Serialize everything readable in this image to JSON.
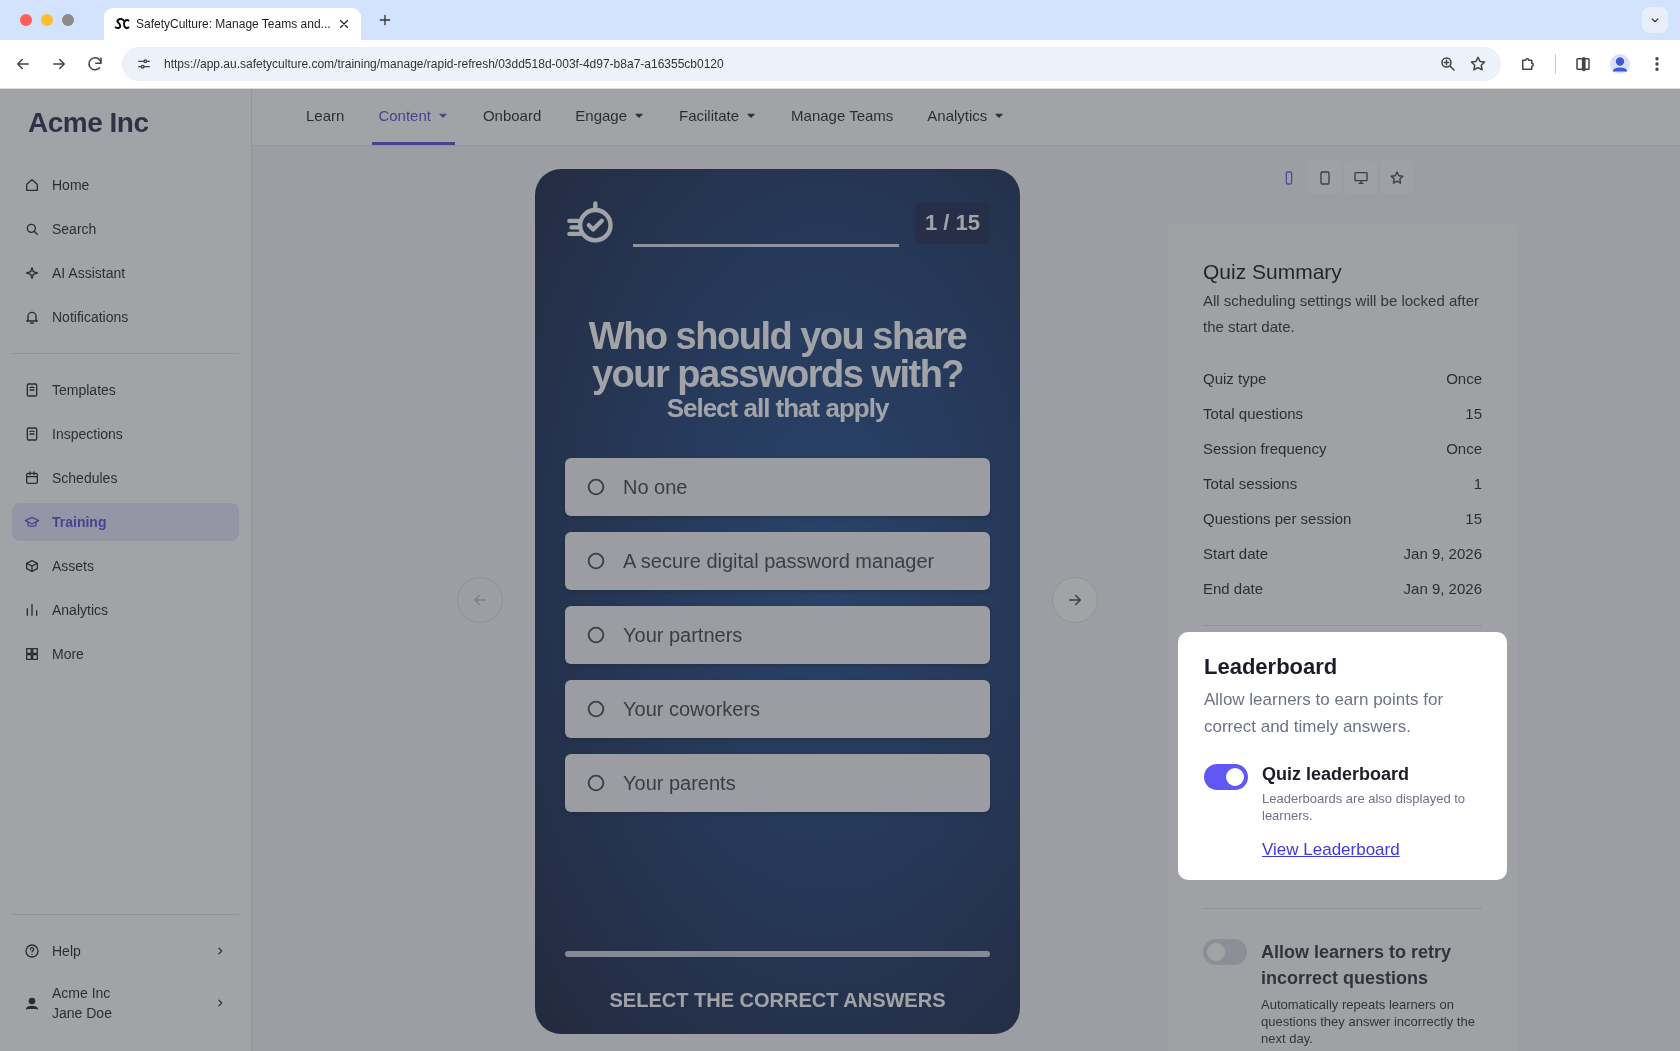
{
  "browser": {
    "tab_title": "SafetyCulture: Manage Teams and...",
    "url": "https://app.au.safetyculture.com/training/manage/rapid-refresh/03dd518d-003f-4d97-b8a7-a16355cb0120"
  },
  "sidebar": {
    "logo": "Acme Inc",
    "items": [
      {
        "label": "Home",
        "selected": false
      },
      {
        "label": "Search",
        "selected": false
      },
      {
        "label": "AI Assistant",
        "selected": false
      },
      {
        "label": "Notifications",
        "selected": false
      },
      {
        "label": "Templates",
        "selected": false
      },
      {
        "label": "Inspections",
        "selected": false
      },
      {
        "label": "Schedules",
        "selected": false
      },
      {
        "label": "Training",
        "selected": true
      },
      {
        "label": "Assets",
        "selected": false
      },
      {
        "label": "Analytics",
        "selected": false
      },
      {
        "label": "More",
        "selected": false
      }
    ],
    "help": "Help",
    "org": "Acme Inc",
    "user": "Jane Doe"
  },
  "nav_tabs": [
    {
      "label": "Learn",
      "selected": false,
      "dropdown": false
    },
    {
      "label": "Content",
      "selected": true,
      "dropdown": true
    },
    {
      "label": "Onboard",
      "selected": false,
      "dropdown": false
    },
    {
      "label": "Engage",
      "selected": false,
      "dropdown": true
    },
    {
      "label": "Facilitate",
      "selected": false,
      "dropdown": true
    },
    {
      "label": "Manage Teams",
      "selected": false,
      "dropdown": false
    },
    {
      "label": "Analytics",
      "selected": false,
      "dropdown": true
    }
  ],
  "quiz": {
    "counter": "1 / 15",
    "question": "Who should you share your passwords with?",
    "instruction": "Select all that apply",
    "options": [
      "No one",
      "A secure digital password manager",
      "Your partners",
      "Your coworkers",
      "Your parents"
    ],
    "footer": "SELECT THE CORRECT ANSWERS"
  },
  "device_buttons": [
    {
      "kind": "phone",
      "selected": true
    },
    {
      "kind": "tablet",
      "selected": false
    },
    {
      "kind": "desktop",
      "selected": false
    },
    {
      "kind": "star",
      "selected": false
    }
  ],
  "summary": {
    "title": "Quiz Summary",
    "description": "All scheduling settings will be locked after the start date.",
    "rows": [
      {
        "label": "Quiz type",
        "value": "Once"
      },
      {
        "label": "Total questions",
        "value": "15"
      },
      {
        "label": "Session frequency",
        "value": "Once"
      },
      {
        "label": "Total sessions",
        "value": "1"
      },
      {
        "label": "Questions per session",
        "value": "15"
      },
      {
        "label": "Start date",
        "value": "Jan 9, 2026"
      },
      {
        "label": "End date",
        "value": "Jan 9, 2026"
      }
    ]
  },
  "leaderboard": {
    "title": "Leaderboard",
    "description": "Allow learners to earn points for correct and timely answers.",
    "toggle": {
      "label": "Quiz leaderboard",
      "hint": "Leaderboards are also displayed to learners.",
      "on": true
    },
    "link": "View Leaderboard"
  },
  "retry": {
    "label": "Allow learners to retry incorrect questions",
    "hint": "Automatically repeats learners on questions they answer incorrectly the next day.",
    "on": false
  }
}
